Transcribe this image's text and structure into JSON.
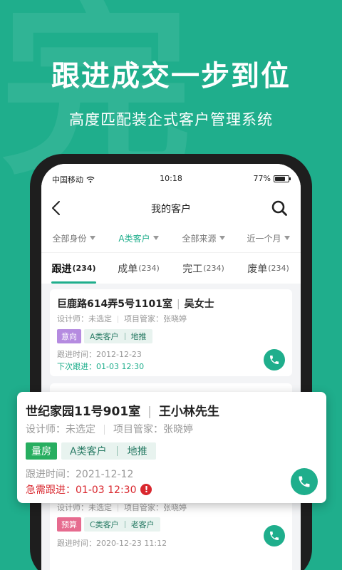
{
  "hero": {
    "watermark": "完",
    "title": "跟进成交一步到位",
    "subtitle": "高度匹配装企式客户管理系统"
  },
  "status_bar": {
    "carrier": "中国移动",
    "time": "10:18",
    "battery": "77%",
    "battery_level": 0.77
  },
  "nav": {
    "title": "我的客户"
  },
  "filters": [
    {
      "label": "全部身份",
      "active": false
    },
    {
      "label": "A类客户",
      "active": true
    },
    {
      "label": "全部来源",
      "active": false
    },
    {
      "label": "近一个月",
      "active": false
    }
  ],
  "tabs": [
    {
      "label": "跟进",
      "count": "(234)",
      "active": true
    },
    {
      "label": "成单",
      "count": "(234)",
      "active": false
    },
    {
      "label": "完工",
      "count": "(234)",
      "active": false
    },
    {
      "label": "废单",
      "count": "(234)",
      "active": false
    }
  ],
  "cards": [
    {
      "address": "巨鹿路614弄5号1101室",
      "customer": "吴女士",
      "designer": "设计师：未选定",
      "manager": "项目管家：张晓婷",
      "status_tag": "意向",
      "class_tag": "A类客户",
      "source_tag": "地推",
      "followup_time": "跟进时间：2012-12-23",
      "next_followup": "下次跟进：01-03 12:30"
    },
    {
      "designer": "设计师：未选定",
      "manager": "项目管家：张晓婷",
      "status_tag": "预算",
      "class_tag": "C类客户",
      "source_tag": "老客户",
      "followup_time": "跟进时间：2020-12-23 11:12"
    }
  ],
  "popup": {
    "address": "世纪家园11号901室",
    "customer": "王小林先生",
    "designer": "设计师：未选定",
    "manager": "项目管家：张晓婷",
    "status_tag": "量房",
    "class_tag": "A类客户",
    "source_tag": "地推",
    "followup_time": "跟进时间：2021-12-12",
    "urgent_followup": "急需跟进：01-03 12:30"
  },
  "colors": {
    "brand": "#1fae8c",
    "urgent": "#d9272e",
    "tag_intent": "#b58be0",
    "tag_budget": "#e66b8f",
    "tag_measure": "#27ae60"
  },
  "icons": [
    "wifi-icon",
    "battery-icon",
    "back-arrow-icon",
    "search-icon",
    "phone-call-icon",
    "warning-icon"
  ]
}
